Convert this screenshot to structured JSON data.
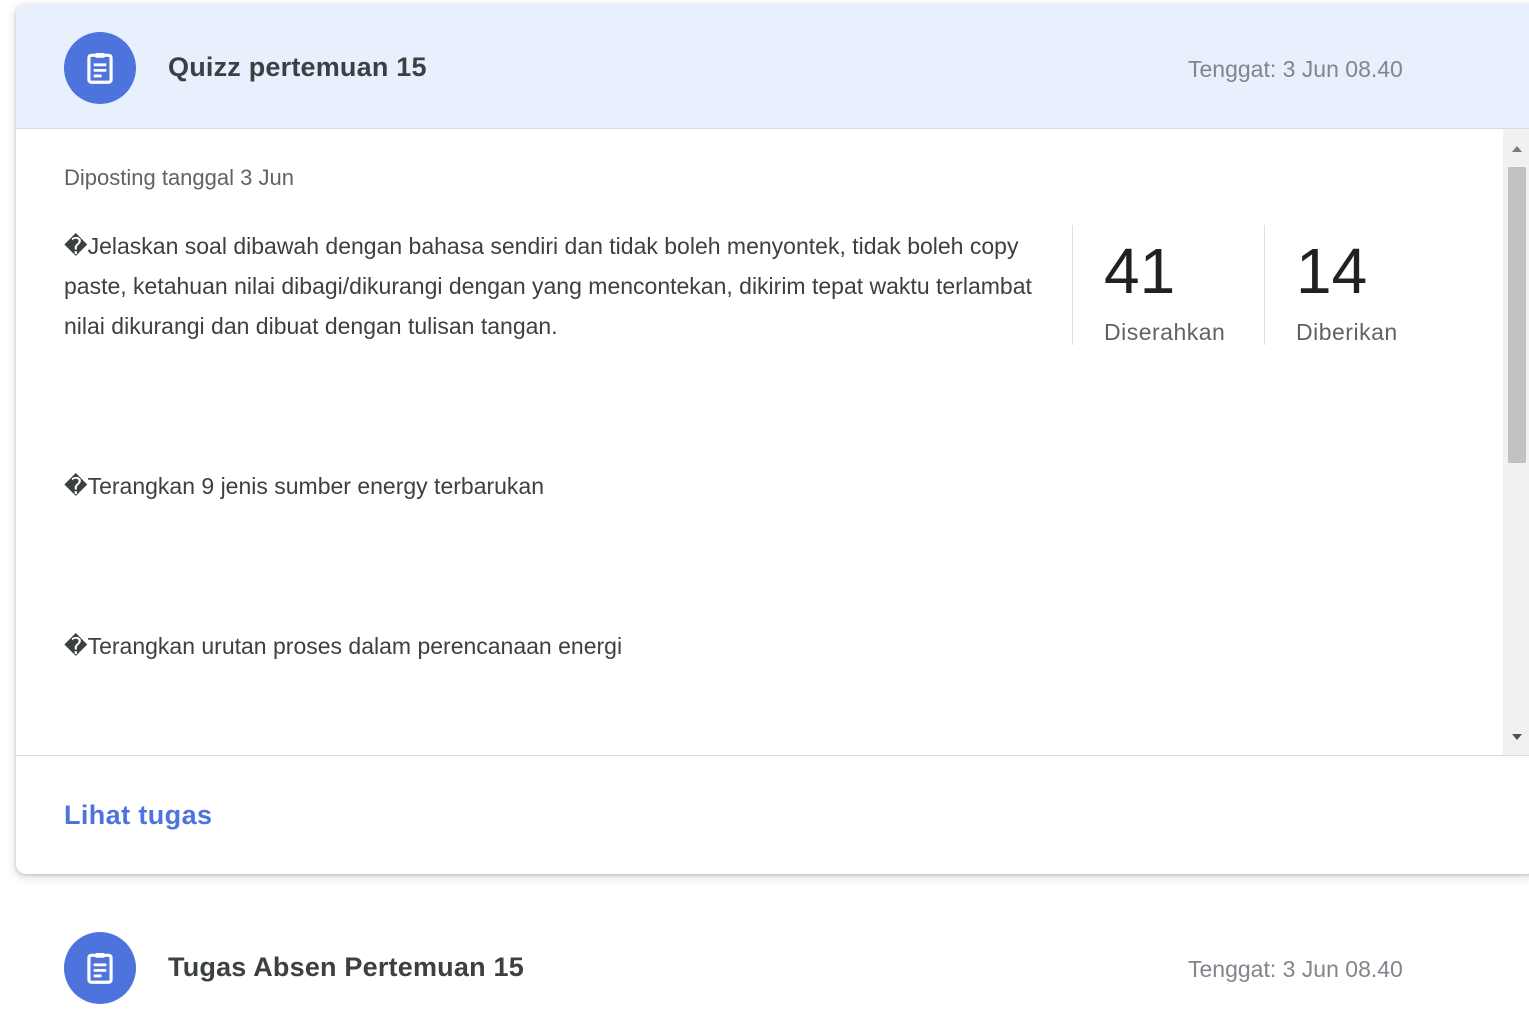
{
  "assignments": [
    {
      "icon": "assignment-icon",
      "title": "Quizz pertemuan 15",
      "due": "Tenggat: 3 Jun 08.40",
      "posted": "Diposting tanggal 3 Jun",
      "description": [
        "�Jelaskan  soal dibawah dengan bahasa sendiri dan tidak boleh menyontek, tidak boleh copy paste, ketahuan nilai dibagi/dikurangi dengan yang mencontekan, dikirim tepat waktu terlambat nilai dikurangi dan dibuat dengan tulisan tangan.",
        "�Terangkan 9 jenis sumber energy terbarukan",
        "�Terangkan urutan proses dalam perencanaan energi"
      ],
      "stats": {
        "submitted": {
          "value": "41",
          "label": "Diserahkan"
        },
        "assigned": {
          "value": "14",
          "label": "Diberikan"
        }
      },
      "action": "Lihat tugas"
    },
    {
      "icon": "assignment-icon",
      "title": "Tugas Absen Pertemuan 15",
      "due": "Tenggat: 3 Jun 08.40"
    }
  ],
  "colors": {
    "accent": "#4c74dc",
    "header_bg": "#e8f0fe",
    "muted_text": "#80868b"
  }
}
